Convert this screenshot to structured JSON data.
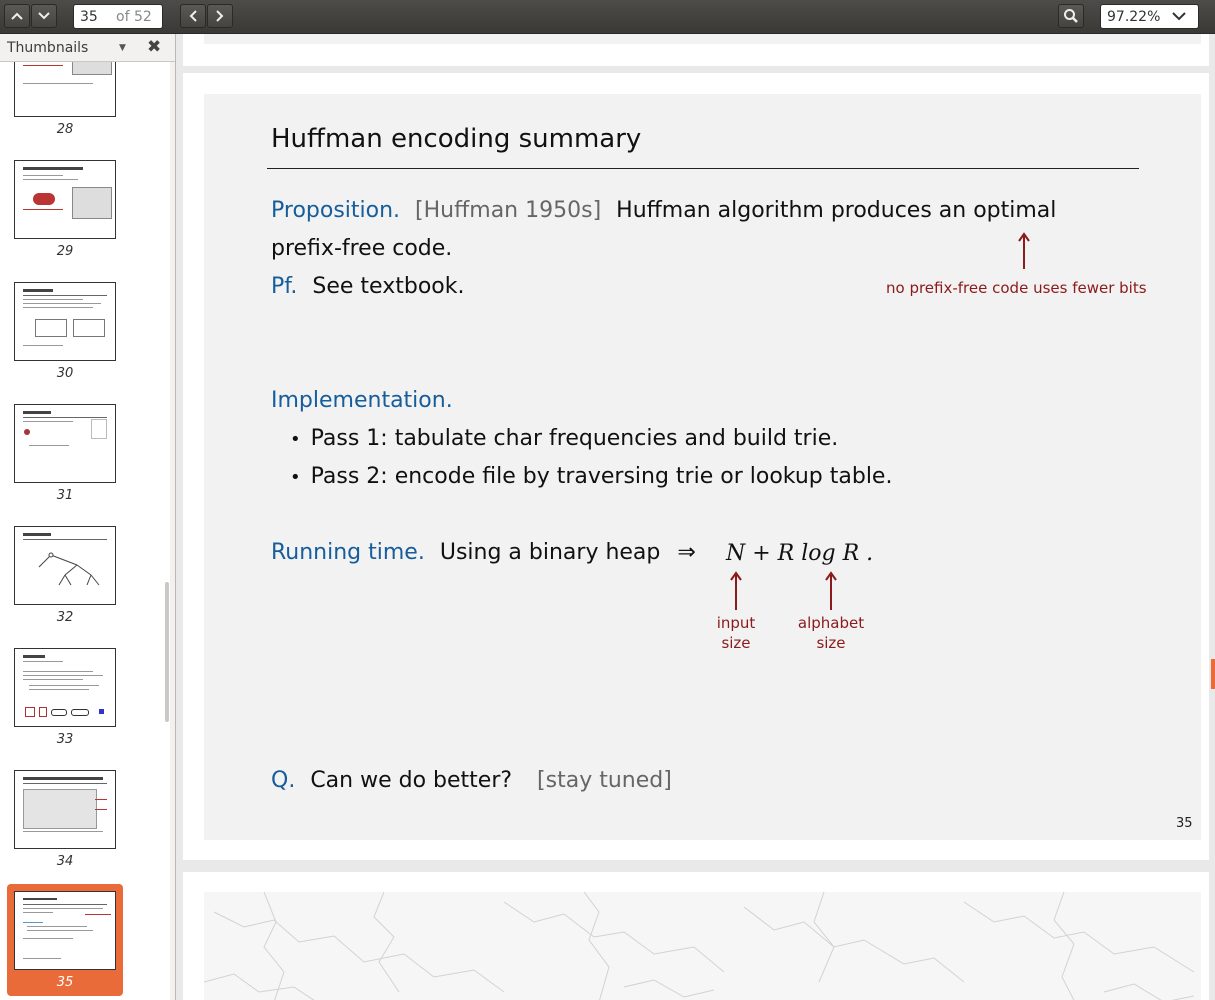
{
  "toolbar": {
    "page_current": "35",
    "page_total": "of 52",
    "zoom": "97.22%"
  },
  "sidebar": {
    "title": "Thumbnails",
    "thumbnails": [
      {
        "num": "28"
      },
      {
        "num": "29"
      },
      {
        "num": "30"
      },
      {
        "num": "31"
      },
      {
        "num": "32"
      },
      {
        "num": "33"
      },
      {
        "num": "34"
      },
      {
        "num": "35"
      }
    ]
  },
  "slide": {
    "title": "Huffman encoding summary",
    "proposition_label": "Proposition.",
    "proposition_cite": "[Huffman 1950s]",
    "proposition_text1": "Huffman algorithm produces an optimal",
    "proposition_text2": "prefix-free code.",
    "pf_label": "Pf.",
    "pf_text": "See textbook.",
    "note_fewer_bits": "no prefix-free code uses fewer bits",
    "impl_label": "Implementation.",
    "bullet1": "Pass 1:  tabulate char frequencies and build trie.",
    "bullet2": "Pass 2:  encode file by traversing trie or lookup table.",
    "running_label": "Running time.",
    "running_text": "Using a binary heap",
    "implies": "⇒",
    "formula": "N + R log R .",
    "note_input1": "input",
    "note_input2": "size",
    "note_alpha1": "alphabet",
    "note_alpha2": "size",
    "q_label": "Q.",
    "q_text": "Can we do better?",
    "q_tuned": "[stay tuned]",
    "page_number": "35"
  }
}
